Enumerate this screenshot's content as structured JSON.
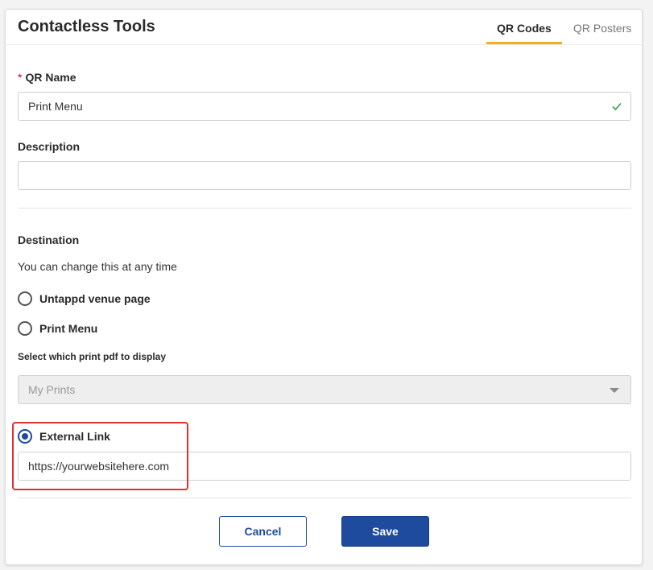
{
  "header": {
    "title": "Contactless Tools",
    "tabs": [
      {
        "label": "QR Codes",
        "active": true
      },
      {
        "label": "QR Posters",
        "active": false
      }
    ]
  },
  "form": {
    "qr_name": {
      "required_marker": "*",
      "label": "QR Name",
      "value": "Print Menu",
      "valid_icon": "check-icon"
    },
    "description": {
      "label": "Description",
      "value": ""
    },
    "destination": {
      "label": "Destination",
      "hint": "You can change this at any time",
      "options": [
        {
          "label": "Untappd venue page",
          "selected": false
        },
        {
          "label": "Print Menu",
          "selected": false
        },
        {
          "label": "External Link",
          "selected": true
        }
      ],
      "print_pdf": {
        "label": "Select which print pdf to display",
        "selected": "My Prints",
        "disabled": true
      },
      "external_link_value": "https://yourwebsitehere.com"
    }
  },
  "actions": {
    "cancel_label": "Cancel",
    "save_label": "Save"
  },
  "colors": {
    "accent": "#f2b01e",
    "primary": "#1e4b9e",
    "valid": "#2e9e44",
    "highlight": "#e0312f"
  }
}
